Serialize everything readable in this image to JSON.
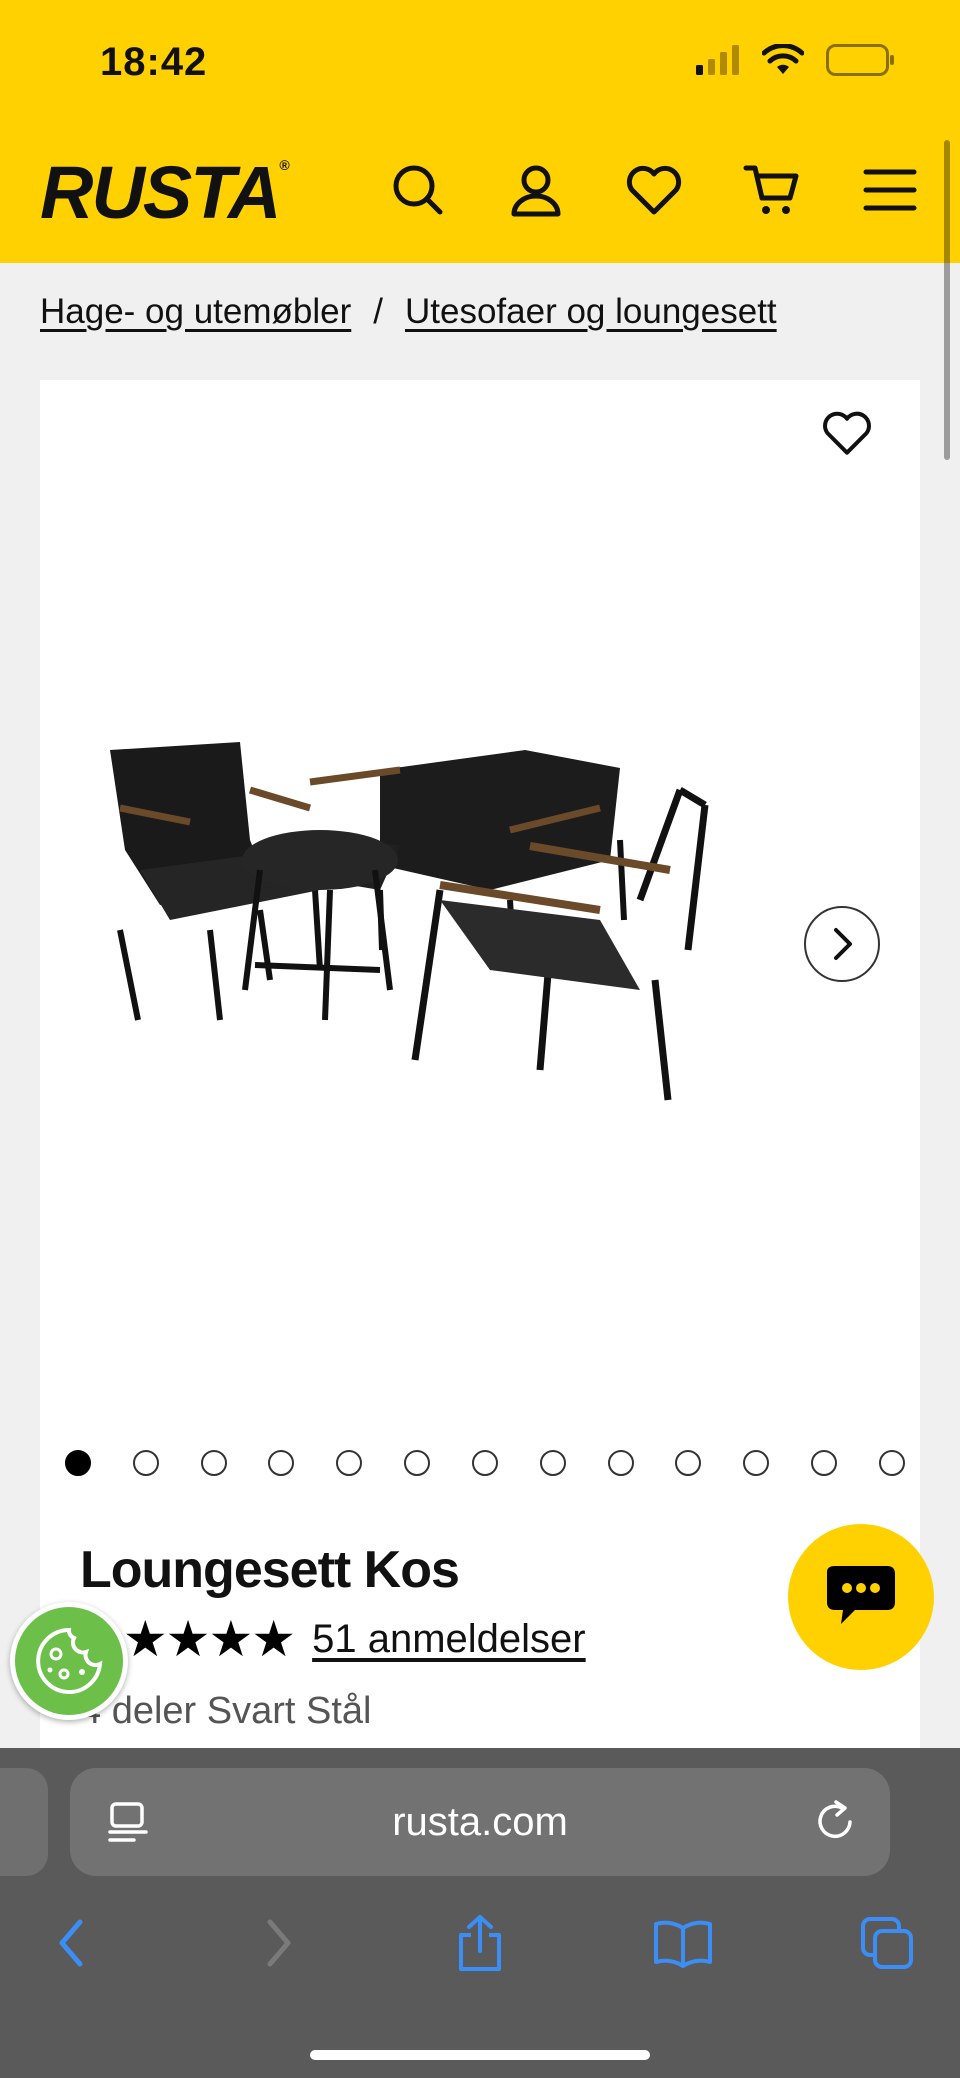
{
  "status_bar": {
    "time": "18:42"
  },
  "header": {
    "logo": "RUSTA"
  },
  "breadcrumb": {
    "items": [
      "Hage- og utemøbler",
      "Utesofaer og loungesett"
    ],
    "separator": "/"
  },
  "product": {
    "title": "Loungesett Kos",
    "stars": "★★★★★",
    "rating_value": 5,
    "reviews_link": "51 anmeldelser",
    "variant": "4 deler Svart Stål",
    "gallery_total": 13,
    "gallery_active": 1
  },
  "browser": {
    "url": "rusta.com"
  },
  "colors": {
    "brand_yellow": "#ffd100",
    "cookie_green": "#6cc04a",
    "browser_blue": "#3a8ef6"
  }
}
